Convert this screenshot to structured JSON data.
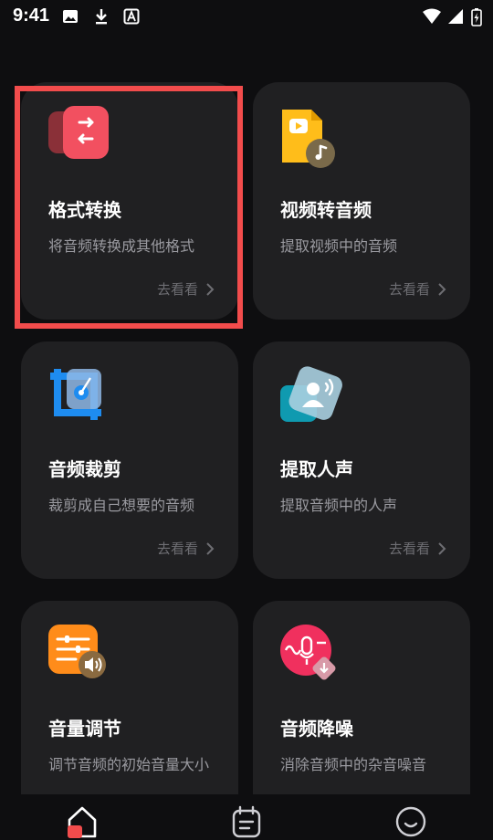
{
  "status_bar": {
    "time": "9:41"
  },
  "cards": [
    {
      "title": "格式转换",
      "desc": "将音频转换成其他格式",
      "more": "去看看"
    },
    {
      "title": "视频转音频",
      "desc": "提取视频中的音频",
      "more": "去看看"
    },
    {
      "title": "音频裁剪",
      "desc": "裁剪成自己想要的音频",
      "more": "去看看"
    },
    {
      "title": "提取人声",
      "desc": "提取音频中的人声",
      "more": "去看看"
    },
    {
      "title": "音量调节",
      "desc": "调节音频的初始音量大小",
      "more": ""
    },
    {
      "title": "音频降噪",
      "desc": "消除音频中的杂音噪音",
      "more": ""
    }
  ],
  "colors": {
    "accent_red": "#f24c4c",
    "card_bg": "#202022",
    "page_bg": "#0e0e10"
  },
  "icons": [
    "format-convert-icon",
    "video-to-audio-icon",
    "audio-crop-icon",
    "vocal-extract-icon",
    "volume-adjust-icon",
    "noise-reduction-icon",
    "home-icon",
    "tasks-icon",
    "profile-icon"
  ]
}
